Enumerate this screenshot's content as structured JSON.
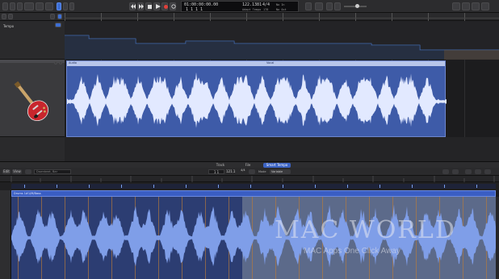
{
  "toolbar": {
    "btn_library": "",
    "btn_inspector": "",
    "btn_toolbar": "",
    "btn_smart_controls": "",
    "lcd_time": "01:00:00:00.00",
    "lcd_bars": "1  1  1     1",
    "lcd_tempo": "122.1381",
    "lcd_signature": "4/4",
    "lcd_tempo_label": "Adapt Tempo",
    "lcd_key": "No In",
    "lcd_sig_label": "178",
    "lcd_key2": "No Out",
    "right_btn_1": "Edit",
    "right_btn_2": "Functions",
    "right_btn_3": "View",
    "edit_menu": "",
    "snap": "Snap",
    "snap_value": "Smart",
    "drag": "Drag",
    "drag_value": "Overlap"
  },
  "tracks": {
    "tempo_label": "Tempo",
    "audio_region_name": "Audio",
    "audio_region_label2": "Vocal"
  },
  "editor": {
    "tab_track": "Track",
    "tab_file": "File",
    "tab_smart_tempo": "Smart Tempo",
    "edit_label": "Edit",
    "view_label": "View",
    "region_name_placeholder": "Downbeat, Bar",
    "position_display": "1  1",
    "tempo_display": "121.1",
    "signature_display": "4/4",
    "mode_label": "Mode",
    "mode_value": "Variable",
    "region_bar_label": "Drums 1#1/M/Bass"
  },
  "watermark": {
    "main": "MAC WORLD",
    "sub": "MAC Apps One Click Away"
  }
}
